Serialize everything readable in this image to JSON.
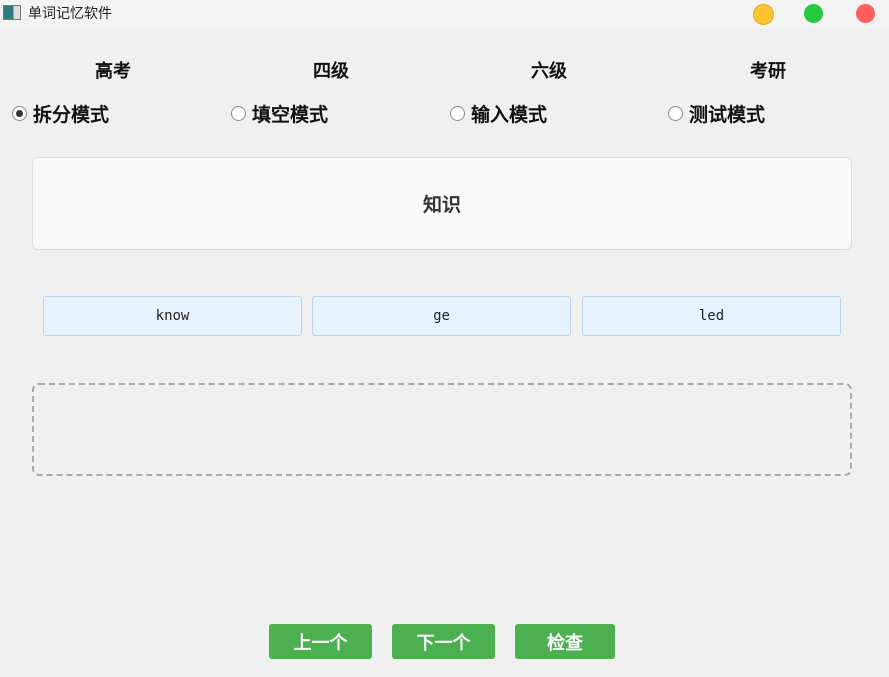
{
  "window": {
    "title": "单词记忆软件",
    "colors": {
      "minimize": "#fec52e",
      "maximize": "#28c840",
      "close": "#fe5f57"
    }
  },
  "levels": [
    "高考",
    "四级",
    "六级",
    "考研"
  ],
  "modes": [
    {
      "label": "拆分模式",
      "checked": true
    },
    {
      "label": "填空模式",
      "checked": false
    },
    {
      "label": "输入模式",
      "checked": false
    },
    {
      "label": "测试模式",
      "checked": false
    }
  ],
  "meaning": "知识",
  "parts": [
    "know",
    "ge",
    "led"
  ],
  "buttons": {
    "prev": "上一个",
    "next": "下一个",
    "check": "检查"
  },
  "accent": "#4caf50"
}
